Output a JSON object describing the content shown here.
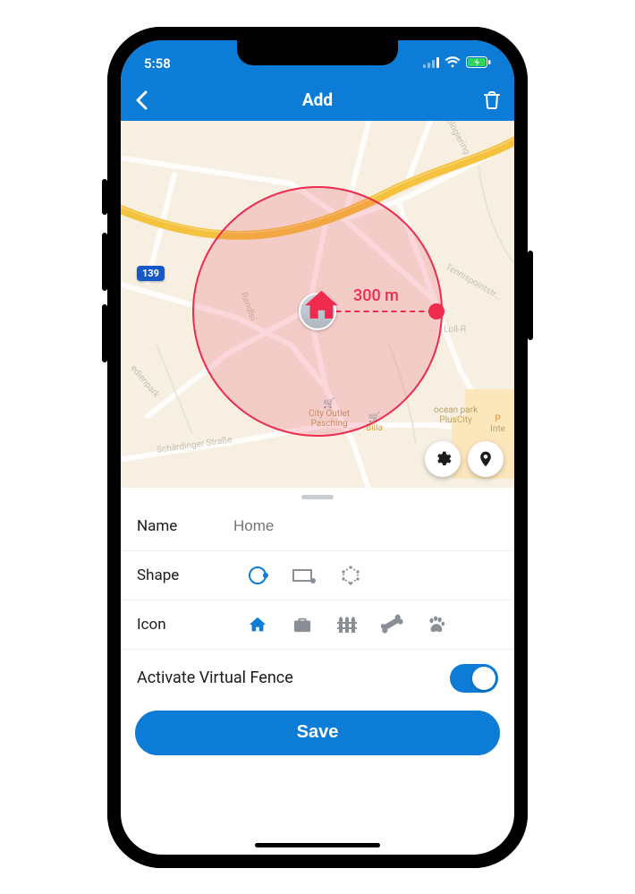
{
  "status": {
    "time": "5:58",
    "cellular_icon": "cellular-bars",
    "wifi_icon": "wifi",
    "battery_icon": "battery-charging"
  },
  "nav": {
    "back_icon": "chevron-left",
    "title": "Add",
    "trash_icon": "trash"
  },
  "map": {
    "radius_label": "300 m",
    "route_badge": "139",
    "poi": {
      "city_outlet_line1": "City Outlet",
      "city_outlet_line2": "Pasching",
      "billa": "Billa",
      "ocean_line1": "ocean park",
      "ocean_line2": "PlusCity",
      "bottom_right_line2": "Inte",
      "tennis": "Tennispointstr...",
      "tech": "Technologiering",
      "rand": "Randlsi",
      "edien": "edienpark",
      "schard": "Schärdinger Straße",
      "loll": "Loll-R"
    },
    "fab_gear": "gear-icon",
    "fab_pin": "location-icon",
    "center_icon": "home-marker"
  },
  "form": {
    "name": {
      "label": "Name",
      "placeholder": "Home",
      "value": ""
    },
    "shape": {
      "label": "Shape",
      "options": [
        "circle",
        "rectangle",
        "polygon"
      ],
      "selected": "circle"
    },
    "icon": {
      "label": "Icon",
      "options": [
        "home",
        "briefcase",
        "fence",
        "bone",
        "paw"
      ],
      "selected": "home"
    },
    "activate": {
      "label": "Activate Virtual Fence",
      "value": true
    },
    "save_label": "Save"
  }
}
